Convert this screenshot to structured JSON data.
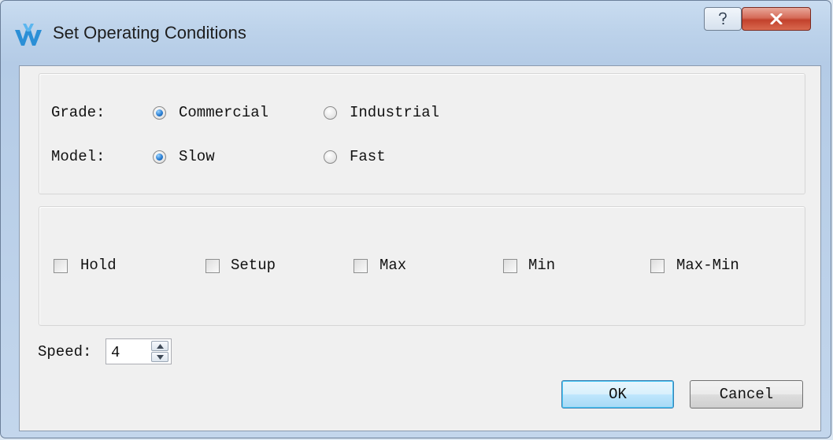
{
  "window": {
    "title": "Set Operating Conditions"
  },
  "title_buttons": {
    "help": "?",
    "close": "x"
  },
  "grade": {
    "label": "Grade:",
    "options": [
      "Commercial",
      "Industrial"
    ],
    "selected": "Commercial"
  },
  "model": {
    "label": "Model:",
    "options": [
      "Slow",
      "Fast"
    ],
    "selected": "Slow"
  },
  "analysis": {
    "checkboxes": [
      {
        "label": "Hold",
        "checked": false
      },
      {
        "label": "Setup",
        "checked": false
      },
      {
        "label": "Max",
        "checked": false
      },
      {
        "label": "Min",
        "checked": false
      },
      {
        "label": "Max-Min",
        "checked": false
      }
    ]
  },
  "speed": {
    "label": "Speed:",
    "value": "4"
  },
  "buttons": {
    "ok": "OK",
    "cancel": "Cancel"
  },
  "colors": {
    "window_frame": "#b4cbe6",
    "client_bg": "#f0f0f0",
    "close_button": "#c2412c",
    "radio_selected": "#2a7fd4"
  }
}
